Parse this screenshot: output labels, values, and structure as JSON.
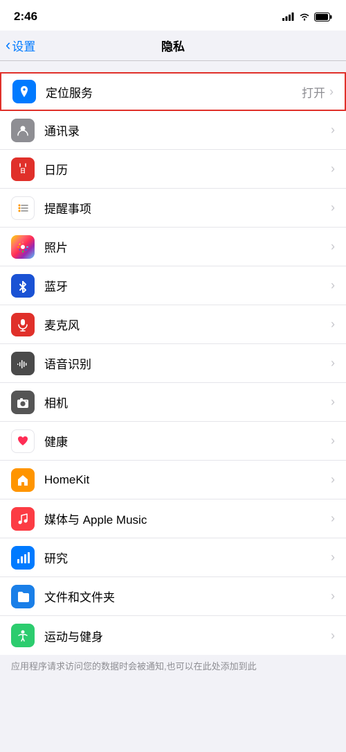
{
  "statusBar": {
    "time": "2:46",
    "signal": "signal",
    "wifi": "wifi",
    "battery": "battery"
  },
  "navBar": {
    "backLabel": "设置",
    "title": "隐私"
  },
  "rows": [
    {
      "id": "location",
      "label": "定位服务",
      "value": "打开",
      "iconColor": "blue",
      "iconType": "location",
      "highlighted": true
    },
    {
      "id": "contacts",
      "label": "通讯录",
      "value": "",
      "iconColor": "gray",
      "iconType": "contacts",
      "highlighted": false
    },
    {
      "id": "calendar",
      "label": "日历",
      "value": "",
      "iconColor": "red",
      "iconType": "calendar",
      "highlighted": false
    },
    {
      "id": "reminders",
      "label": "提醒事项",
      "value": "",
      "iconColor": "gray",
      "iconType": "reminders",
      "highlighted": false
    },
    {
      "id": "photos",
      "label": "照片",
      "value": "",
      "iconColor": "gradient-photos",
      "iconType": "photos",
      "highlighted": false
    },
    {
      "id": "bluetooth",
      "label": "蓝牙",
      "value": "",
      "iconColor": "blue-dark",
      "iconType": "bluetooth",
      "highlighted": false
    },
    {
      "id": "microphone",
      "label": "麦克风",
      "value": "",
      "iconColor": "red",
      "iconType": "microphone",
      "highlighted": false
    },
    {
      "id": "speech",
      "label": "语音识别",
      "value": "",
      "iconColor": "gray-dark",
      "iconType": "speech",
      "highlighted": false
    },
    {
      "id": "camera",
      "label": "相机",
      "value": "",
      "iconColor": "dark",
      "iconType": "camera",
      "highlighted": false
    },
    {
      "id": "health",
      "label": "健康",
      "value": "",
      "iconColor": "pink",
      "iconType": "health",
      "highlighted": false
    },
    {
      "id": "homekit",
      "label": "HomeKit",
      "value": "",
      "iconColor": "orange",
      "iconType": "homekit",
      "highlighted": false
    },
    {
      "id": "media",
      "label": "媒体与 Apple Music",
      "value": "",
      "iconColor": "pink-light",
      "iconType": "music",
      "highlighted": false
    },
    {
      "id": "research",
      "label": "研究",
      "value": "",
      "iconColor": "blue-chart",
      "iconType": "research",
      "highlighted": false
    },
    {
      "id": "files",
      "label": "文件和文件夹",
      "value": "",
      "iconColor": "blue-folder",
      "iconType": "files",
      "highlighted": false
    },
    {
      "id": "fitness",
      "label": "运动与健身",
      "value": "",
      "iconColor": "green-fitness",
      "iconType": "fitness",
      "highlighted": false
    }
  ],
  "bottomNote": "应用程序请求访问您的数据时会被通知,也可以在此处添加到此"
}
